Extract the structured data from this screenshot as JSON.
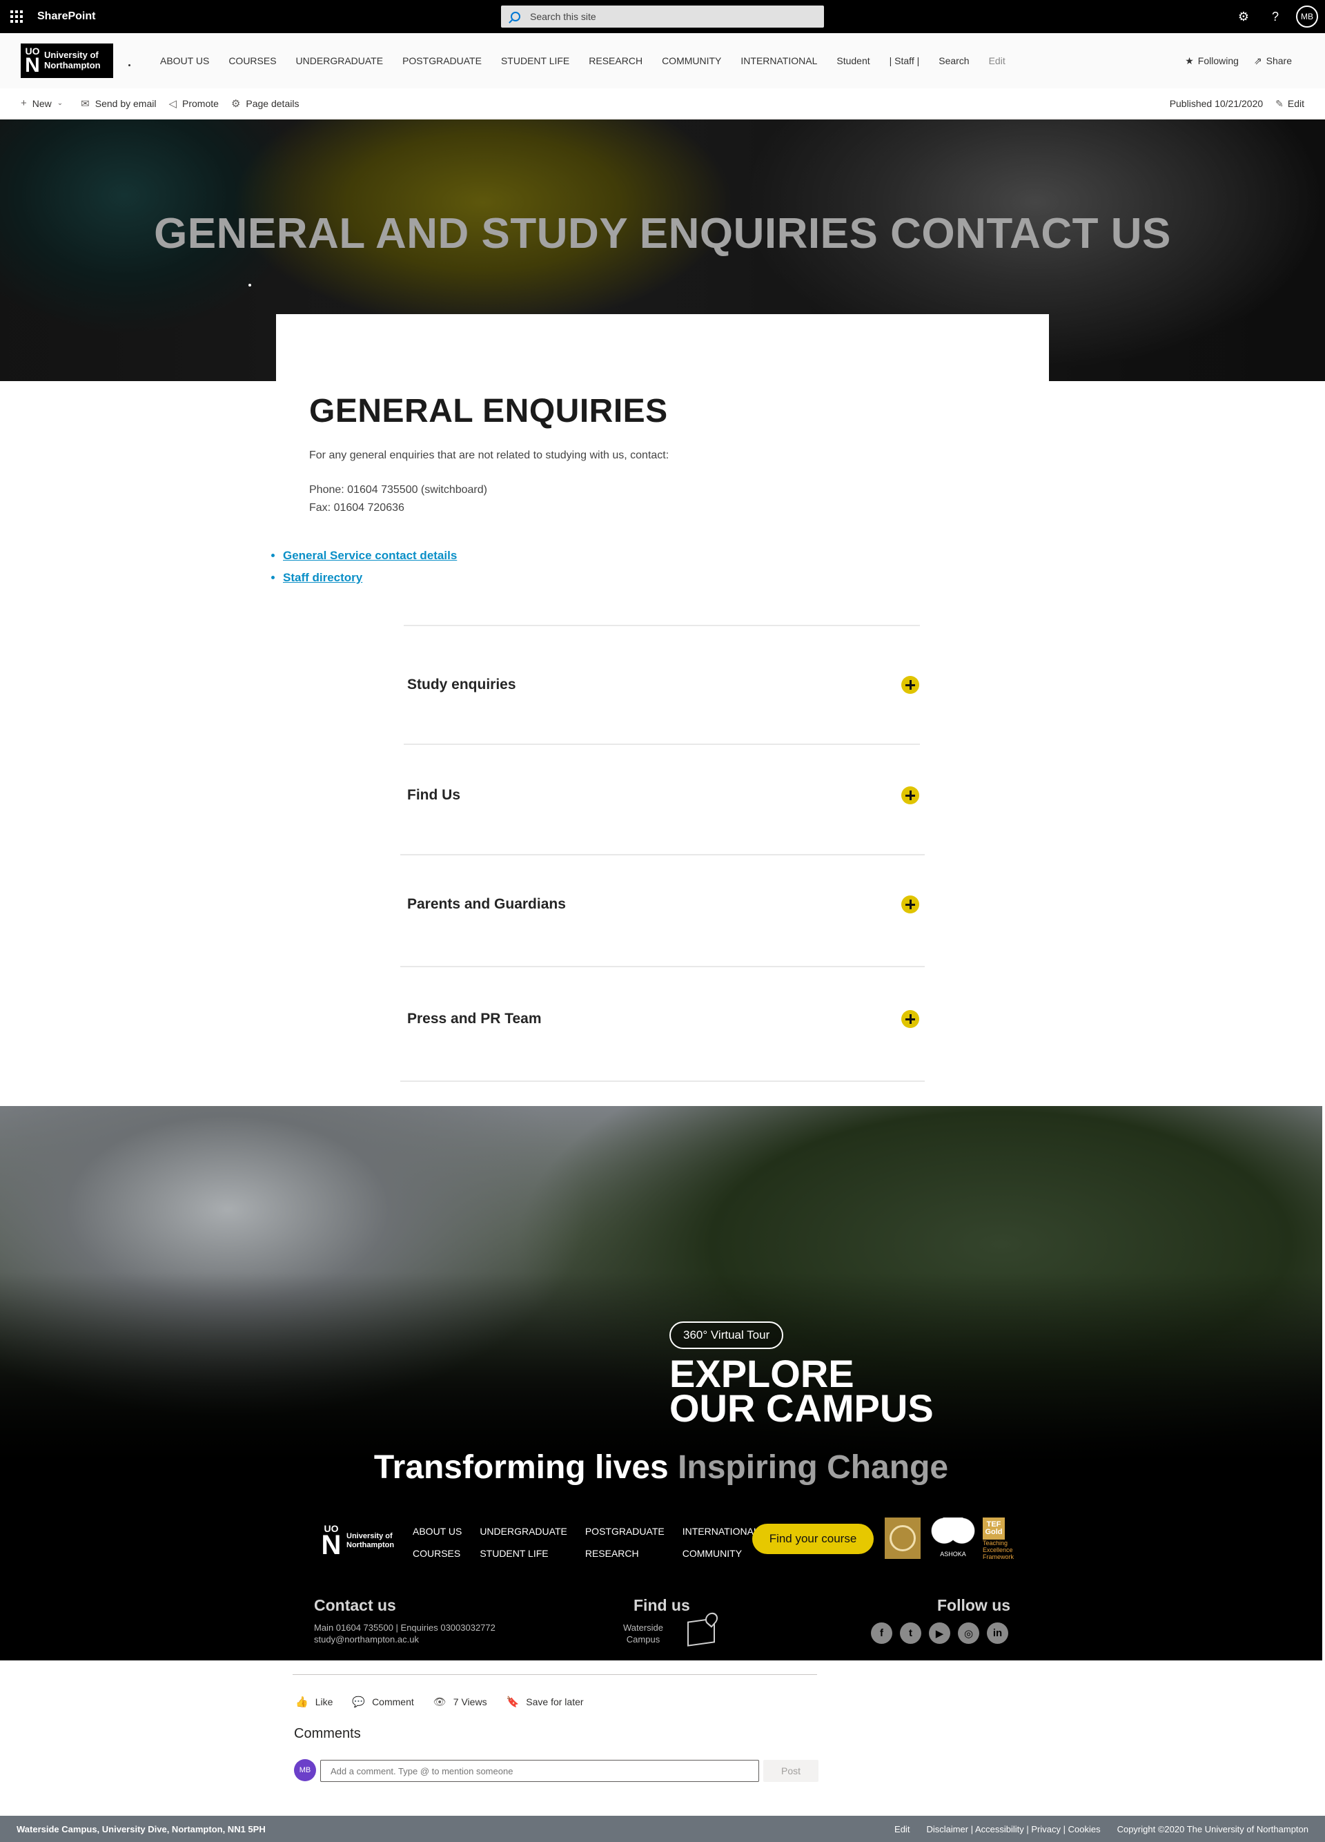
{
  "suitebar": {
    "brand": "SharePoint",
    "search_placeholder": "Search this site",
    "avatar": "MB",
    "icons": [
      "app-launcher-icon",
      "settings-icon",
      "help-icon"
    ]
  },
  "site": {
    "logo_mark": "UO",
    "logo_big": "N",
    "logo_line1": "University of",
    "logo_line2": "Northampton",
    "nav": [
      "ABOUT US",
      "COURSES",
      "UNDERGRADUATE",
      "POSTGRADUATE",
      "STUDENT LIFE",
      "RESEARCH",
      "COMMUNITY",
      "INTERNATIONAL",
      "Student",
      "| Staff |",
      "Search",
      "Edit"
    ],
    "following": "Following",
    "share": "Share"
  },
  "command_bar": {
    "new": "New",
    "send_by_email": "Send by email",
    "promote": "Promote",
    "page_details": "Page details",
    "published": "Published 10/21/2020",
    "edit": "Edit"
  },
  "hero": {
    "title": "GENERAL AND STUDY ENQUIRIES CONTACT US"
  },
  "general": {
    "title": "GENERAL ENQUIRIES",
    "intro": "For any general enquiries that are not related to studying with us, contact:",
    "phone": "Phone: 01604 735500 (switchboard)",
    "fax": "Fax: 01604 720636",
    "links": [
      "General Service contact details",
      "Staff directory"
    ]
  },
  "accordion": [
    {
      "label": "Study enquiries"
    },
    {
      "label": "Find Us"
    },
    {
      "label": "Parents and Guardians"
    },
    {
      "label": "Press and PR Team"
    }
  ],
  "campus": {
    "tour_label": "360° Virtual Tour",
    "explore_line1": "EXPLORE",
    "explore_line2": "OUR CAMPUS"
  },
  "footer": {
    "tagline_main": "Transforming lives",
    "tagline_alt": "Inspiring Change",
    "nav": [
      "ABOUT US",
      "UNDERGRADUATE",
      "POSTGRADUATE",
      "INTERNATIONAL",
      "COURSES",
      "STUDENT LIFE",
      "RESEARCH",
      "COMMUNITY"
    ],
    "find_course": "Find your course",
    "award_ashoka": "ASHOKA",
    "award_tef": "TEF Gold",
    "award_tef_small": "Teaching Excellence Framework",
    "contact_title": "Contact us",
    "contact_line1": "Main 01604 735500 | Enquiries 03003032772",
    "contact_line2": "study@northampton.ac.uk",
    "find_title": "Find us",
    "find_line1": "Waterside",
    "find_line2": "Campus",
    "follow_title": "Follow us",
    "social": [
      "f",
      "t",
      "▶",
      "◎",
      "in"
    ]
  },
  "social_bar": {
    "like": "Like",
    "comment": "Comment",
    "views": "7 Views",
    "save": "Save for later"
  },
  "comments": {
    "title": "Comments",
    "avatar": "MB",
    "placeholder": "Add a comment. Type @ to mention someone",
    "post": "Post"
  },
  "bottom_bar": {
    "address": "Waterside Campus, University Dive, Nortampton, NN1 5PH",
    "edit": "Edit",
    "links": "Disclaimer | Accessibility | Privacy | Cookies",
    "copyright": "Copyright ©2020 The University of Northampton"
  }
}
